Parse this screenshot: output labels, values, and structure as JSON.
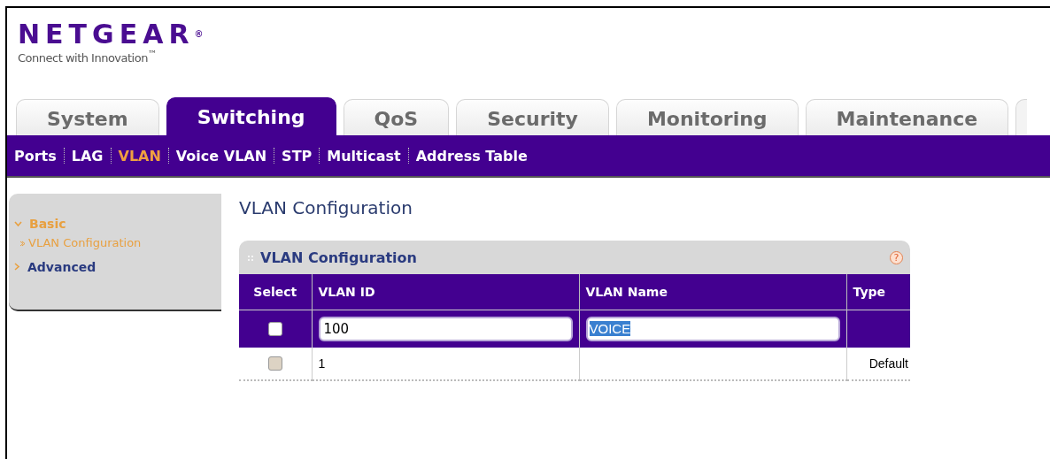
{
  "logo": {
    "brand": "NETGEAR",
    "registered": "®",
    "tagline": "Connect with Innovation",
    "trademark": "™"
  },
  "tabs": [
    {
      "label": "System",
      "selected": false
    },
    {
      "label": "Switching",
      "selected": true
    },
    {
      "label": "QoS",
      "selected": false
    },
    {
      "label": "Security",
      "selected": false
    },
    {
      "label": "Monitoring",
      "selected": false
    },
    {
      "label": "Maintenance",
      "selected": false
    }
  ],
  "subnav": [
    {
      "label": "Ports",
      "selected": false
    },
    {
      "label": "LAG",
      "selected": false
    },
    {
      "label": "VLAN",
      "selected": true
    },
    {
      "label": "Voice VLAN",
      "selected": false
    },
    {
      "label": "STP",
      "selected": false
    },
    {
      "label": "Multicast",
      "selected": false
    },
    {
      "label": "Address Table",
      "selected": false
    }
  ],
  "sidebar": {
    "items": [
      {
        "label": "Basic",
        "expanded": true,
        "children": [
          {
            "label": "VLAN Configuration",
            "selected": true
          }
        ]
      },
      {
        "label": "Advanced",
        "expanded": false
      }
    ]
  },
  "page_title": "VLAN Configuration",
  "panel": {
    "title": "VLAN Configuration",
    "help": "?",
    "columns": [
      "Select",
      "VLAN ID",
      "VLAN Name",
      "Type"
    ],
    "rows": [
      {
        "kind": "edit",
        "checked": false,
        "vlan_id": "100",
        "vlan_name": "VOICE"
      },
      {
        "kind": "entry",
        "checked": false,
        "vlan_id": "1",
        "vlan_name": "",
        "type": "Default"
      }
    ]
  }
}
